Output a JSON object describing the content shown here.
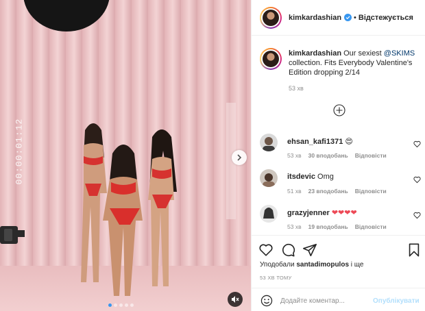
{
  "media": {
    "timecode": "00:00:01:12",
    "carousel": {
      "count": 5,
      "active": 1
    },
    "icons": [
      "camera-icon",
      "chevron-right-icon",
      "speaker-muted-icon"
    ]
  },
  "header": {
    "username": "kimkardashian",
    "separator": "•",
    "follow_label": "Відстежується"
  },
  "caption": {
    "username": "kimkardashian",
    "text_before": "Our sexiest ",
    "tag": "@SKIMS",
    "text_after": " collection. Fits Everybody Valentine's Edition dropping 2/14",
    "time": "53 хв"
  },
  "comments": [
    {
      "username": "ehsan_kafi1371",
      "text": "😍",
      "time": "53 хв",
      "likes": "30 вподобань",
      "reply": "Відповісти"
    },
    {
      "username": "itsdevic",
      "text": "Omg",
      "time": "51 хв",
      "likes": "23 вподобань",
      "reply": "Відповісти"
    },
    {
      "username": "grazyjenner",
      "text": "❤❤❤❤",
      "time": "53 хв",
      "likes": "19 вподобань",
      "reply": "Відповісти"
    }
  ],
  "likes": {
    "prefix": "Уподобали ",
    "user": "santadimopulos",
    "suffix": " і ще"
  },
  "posted": "53 ХВ ТОМУ",
  "add_comment": {
    "placeholder": "Додайте коментар...",
    "publish_label": "Опублікувати"
  },
  "colors": {
    "accent": "#3897f0",
    "heart_red": "#ed4956",
    "tag_blue": "#00376b",
    "publish_disabled": "#b2dffc",
    "muted_text": "#8e8e8e",
    "backdrop_pink": "#e9c1c3"
  }
}
